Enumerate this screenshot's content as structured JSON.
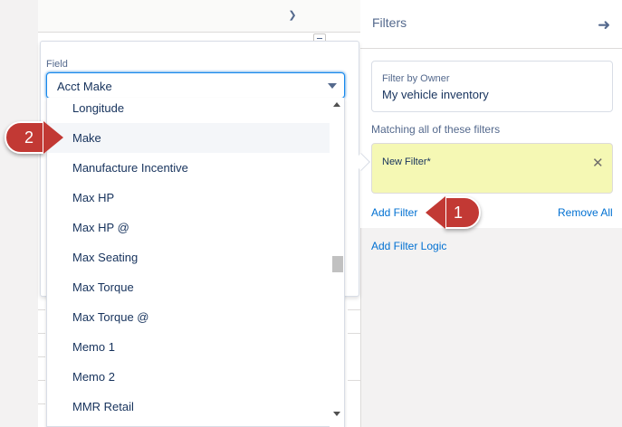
{
  "filters_panel": {
    "title": "Filters",
    "close_icon": "arrow-right-icon",
    "owner_filter": {
      "label": "Filter by Owner",
      "value": "My vehicle inventory"
    },
    "matching_label": "Matching all of these filters",
    "new_filter": {
      "label": "New Filter*",
      "remove_icon": "close-icon"
    },
    "add_filter": "Add Filter",
    "remove_all": "Remove All",
    "add_filter_logic": "Add Filter Logic"
  },
  "field_picker": {
    "label": "Field",
    "selected_value": "Acct Make",
    "options": [
      "Longitude",
      "Make",
      "Manufacture Incentive",
      "Max HP",
      "Max HP @",
      "Max Seating",
      "Max Torque",
      "Max Torque @",
      "Memo 1",
      "Memo 2",
      "MMR Retail"
    ],
    "highlighted_option": "Make"
  },
  "callouts": [
    {
      "number": "1",
      "color": "#c23934"
    },
    {
      "number": "2",
      "color": "#c23934"
    }
  ],
  "colors": {
    "accent": "#0070d2",
    "callout": "#c23934",
    "filter_highlight": "#f5f8b4"
  }
}
